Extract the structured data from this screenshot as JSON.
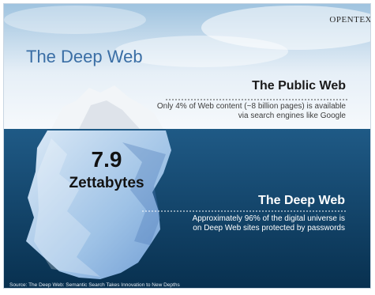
{
  "brand": {
    "logo_text": "OPENTEX"
  },
  "slide": {
    "title": "The Deep Web",
    "public_web": {
      "heading": "The Public Web",
      "description": "Only 4% of Web content (~8 billion pages) is available via search engines like Google"
    },
    "iceberg": {
      "size_value": "7.9",
      "size_unit": "Zettabytes"
    },
    "deep_web": {
      "heading": "The Deep Web",
      "description": "Approximately 96% of the digital universe is on Deep Web sites protected by passwords"
    },
    "source": "Source: The Deep Web: Semantic Search Takes Innovation to New Depths"
  },
  "colors": {
    "sky_top": "#9fc3df",
    "ocean_top": "#1f5a86",
    "ocean_bottom": "#08304f",
    "title_blue": "#3a6ea5"
  },
  "icons": {
    "main_visual": "iceberg-illustration"
  }
}
